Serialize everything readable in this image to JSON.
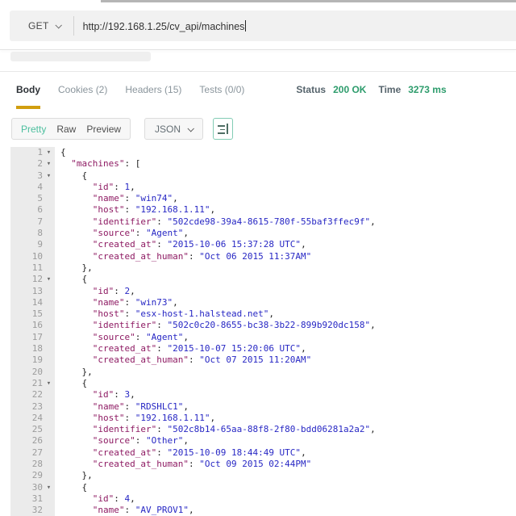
{
  "request_bar": {
    "method": "GET",
    "url": "http://192.168.1.25/cv_api/machines"
  },
  "response": {
    "tabs": [
      {
        "label": "Body",
        "active": true
      },
      {
        "label": "Cookies (2)",
        "active": false
      },
      {
        "label": "Headers (15)",
        "active": false
      },
      {
        "label": "Tests (0/0)",
        "active": false
      }
    ],
    "meta": {
      "status_label": "Status",
      "status_value": "200 OK",
      "time_label": "Time",
      "time_value": "3273 ms"
    },
    "toolbar": {
      "views": [
        "Pretty",
        "Raw",
        "Preview"
      ],
      "active_view": "Pretty",
      "format_select": "JSON"
    }
  },
  "icons": {
    "method_dropdown": "chevron-down-icon",
    "format_dropdown": "chevron-down-icon",
    "beautify_button": "format-align-icon",
    "fold_glyph": "▾"
  },
  "colors": {
    "accent_green": "#4cbf9e",
    "status_green": "#2d9c6c",
    "tab_underline": "#d19e0f",
    "json_key": "#8e1b63",
    "json_value": "#2727c4"
  },
  "editor": {
    "lines": [
      {
        "n": 1,
        "fold": true,
        "parts": [
          [
            "p",
            "{"
          ]
        ]
      },
      {
        "n": 2,
        "fold": true,
        "parts": [
          [
            "p",
            "  "
          ],
          [
            "k",
            "\"machines\""
          ],
          [
            "p",
            ": ["
          ]
        ]
      },
      {
        "n": 3,
        "fold": true,
        "parts": [
          [
            "p",
            "    {"
          ]
        ]
      },
      {
        "n": 4,
        "fold": false,
        "parts": [
          [
            "p",
            "      "
          ],
          [
            "k",
            "\"id\""
          ],
          [
            "p",
            ": "
          ],
          [
            "v",
            "1"
          ],
          [
            "p",
            ","
          ]
        ]
      },
      {
        "n": 5,
        "fold": false,
        "parts": [
          [
            "p",
            "      "
          ],
          [
            "k",
            "\"name\""
          ],
          [
            "p",
            ": "
          ],
          [
            "v",
            "\"win74\""
          ],
          [
            "p",
            ","
          ]
        ]
      },
      {
        "n": 6,
        "fold": false,
        "parts": [
          [
            "p",
            "      "
          ],
          [
            "k",
            "\"host\""
          ],
          [
            "p",
            ": "
          ],
          [
            "v",
            "\"192.168.1.11\""
          ],
          [
            "p",
            ","
          ]
        ]
      },
      {
        "n": 7,
        "fold": false,
        "parts": [
          [
            "p",
            "      "
          ],
          [
            "k",
            "\"identifier\""
          ],
          [
            "p",
            ": "
          ],
          [
            "v",
            "\"502cde98-39a4-8615-780f-55baf3ffec9f\""
          ],
          [
            "p",
            ","
          ]
        ]
      },
      {
        "n": 8,
        "fold": false,
        "parts": [
          [
            "p",
            "      "
          ],
          [
            "k",
            "\"source\""
          ],
          [
            "p",
            ": "
          ],
          [
            "v",
            "\"Agent\""
          ],
          [
            "p",
            ","
          ]
        ]
      },
      {
        "n": 9,
        "fold": false,
        "parts": [
          [
            "p",
            "      "
          ],
          [
            "k",
            "\"created_at\""
          ],
          [
            "p",
            ": "
          ],
          [
            "v",
            "\"2015-10-06 15:37:28 UTC\""
          ],
          [
            "p",
            ","
          ]
        ]
      },
      {
        "n": 10,
        "fold": false,
        "parts": [
          [
            "p",
            "      "
          ],
          [
            "k",
            "\"created_at_human\""
          ],
          [
            "p",
            ": "
          ],
          [
            "v",
            "\"Oct 06 2015 11:37AM\""
          ]
        ]
      },
      {
        "n": 11,
        "fold": false,
        "parts": [
          [
            "p",
            "    },"
          ]
        ]
      },
      {
        "n": 12,
        "fold": true,
        "parts": [
          [
            "p",
            "    {"
          ]
        ]
      },
      {
        "n": 13,
        "fold": false,
        "parts": [
          [
            "p",
            "      "
          ],
          [
            "k",
            "\"id\""
          ],
          [
            "p",
            ": "
          ],
          [
            "v",
            "2"
          ],
          [
            "p",
            ","
          ]
        ]
      },
      {
        "n": 14,
        "fold": false,
        "parts": [
          [
            "p",
            "      "
          ],
          [
            "k",
            "\"name\""
          ],
          [
            "p",
            ": "
          ],
          [
            "v",
            "\"win73\""
          ],
          [
            "p",
            ","
          ]
        ]
      },
      {
        "n": 15,
        "fold": false,
        "parts": [
          [
            "p",
            "      "
          ],
          [
            "k",
            "\"host\""
          ],
          [
            "p",
            ": "
          ],
          [
            "v",
            "\"esx-host-1.halstead.net\""
          ],
          [
            "p",
            ","
          ]
        ]
      },
      {
        "n": 16,
        "fold": false,
        "parts": [
          [
            "p",
            "      "
          ],
          [
            "k",
            "\"identifier\""
          ],
          [
            "p",
            ": "
          ],
          [
            "v",
            "\"502c0c20-8655-bc38-3b22-899b920dc158\""
          ],
          [
            "p",
            ","
          ]
        ]
      },
      {
        "n": 17,
        "fold": false,
        "parts": [
          [
            "p",
            "      "
          ],
          [
            "k",
            "\"source\""
          ],
          [
            "p",
            ": "
          ],
          [
            "v",
            "\"Agent\""
          ],
          [
            "p",
            ","
          ]
        ]
      },
      {
        "n": 18,
        "fold": false,
        "parts": [
          [
            "p",
            "      "
          ],
          [
            "k",
            "\"created_at\""
          ],
          [
            "p",
            ": "
          ],
          [
            "v",
            "\"2015-10-07 15:20:06 UTC\""
          ],
          [
            "p",
            ","
          ]
        ]
      },
      {
        "n": 19,
        "fold": false,
        "parts": [
          [
            "p",
            "      "
          ],
          [
            "k",
            "\"created_at_human\""
          ],
          [
            "p",
            ": "
          ],
          [
            "v",
            "\"Oct 07 2015 11:20AM\""
          ]
        ]
      },
      {
        "n": 20,
        "fold": false,
        "parts": [
          [
            "p",
            "    },"
          ]
        ]
      },
      {
        "n": 21,
        "fold": true,
        "parts": [
          [
            "p",
            "    {"
          ]
        ]
      },
      {
        "n": 22,
        "fold": false,
        "parts": [
          [
            "p",
            "      "
          ],
          [
            "k",
            "\"id\""
          ],
          [
            "p",
            ": "
          ],
          [
            "v",
            "3"
          ],
          [
            "p",
            ","
          ]
        ]
      },
      {
        "n": 23,
        "fold": false,
        "parts": [
          [
            "p",
            "      "
          ],
          [
            "k",
            "\"name\""
          ],
          [
            "p",
            ": "
          ],
          [
            "v",
            "\"RDSHLC1\""
          ],
          [
            "p",
            ","
          ]
        ]
      },
      {
        "n": 24,
        "fold": false,
        "parts": [
          [
            "p",
            "      "
          ],
          [
            "k",
            "\"host\""
          ],
          [
            "p",
            ": "
          ],
          [
            "v",
            "\"192.168.1.11\""
          ],
          [
            "p",
            ","
          ]
        ]
      },
      {
        "n": 25,
        "fold": false,
        "parts": [
          [
            "p",
            "      "
          ],
          [
            "k",
            "\"identifier\""
          ],
          [
            "p",
            ": "
          ],
          [
            "v",
            "\"502c8b14-65aa-88f8-2f80-bdd06281a2a2\""
          ],
          [
            "p",
            ","
          ]
        ]
      },
      {
        "n": 26,
        "fold": false,
        "parts": [
          [
            "p",
            "      "
          ],
          [
            "k",
            "\"source\""
          ],
          [
            "p",
            ": "
          ],
          [
            "v",
            "\"Other\""
          ],
          [
            "p",
            ","
          ]
        ]
      },
      {
        "n": 27,
        "fold": false,
        "parts": [
          [
            "p",
            "      "
          ],
          [
            "k",
            "\"created_at\""
          ],
          [
            "p",
            ": "
          ],
          [
            "v",
            "\"2015-10-09 18:44:49 UTC\""
          ],
          [
            "p",
            ","
          ]
        ]
      },
      {
        "n": 28,
        "fold": false,
        "parts": [
          [
            "p",
            "      "
          ],
          [
            "k",
            "\"created_at_human\""
          ],
          [
            "p",
            ": "
          ],
          [
            "v",
            "\"Oct 09 2015 02:44PM\""
          ]
        ]
      },
      {
        "n": 29,
        "fold": false,
        "parts": [
          [
            "p",
            "    },"
          ]
        ]
      },
      {
        "n": 30,
        "fold": true,
        "parts": [
          [
            "p",
            "    {"
          ]
        ]
      },
      {
        "n": 31,
        "fold": false,
        "parts": [
          [
            "p",
            "      "
          ],
          [
            "k",
            "\"id\""
          ],
          [
            "p",
            ": "
          ],
          [
            "v",
            "4"
          ],
          [
            "p",
            ","
          ]
        ]
      },
      {
        "n": 32,
        "fold": false,
        "parts": [
          [
            "p",
            "      "
          ],
          [
            "k",
            "\"name\""
          ],
          [
            "p",
            ": "
          ],
          [
            "v",
            "\"AV_PROV1\""
          ],
          [
            "p",
            ","
          ]
        ]
      }
    ]
  }
}
